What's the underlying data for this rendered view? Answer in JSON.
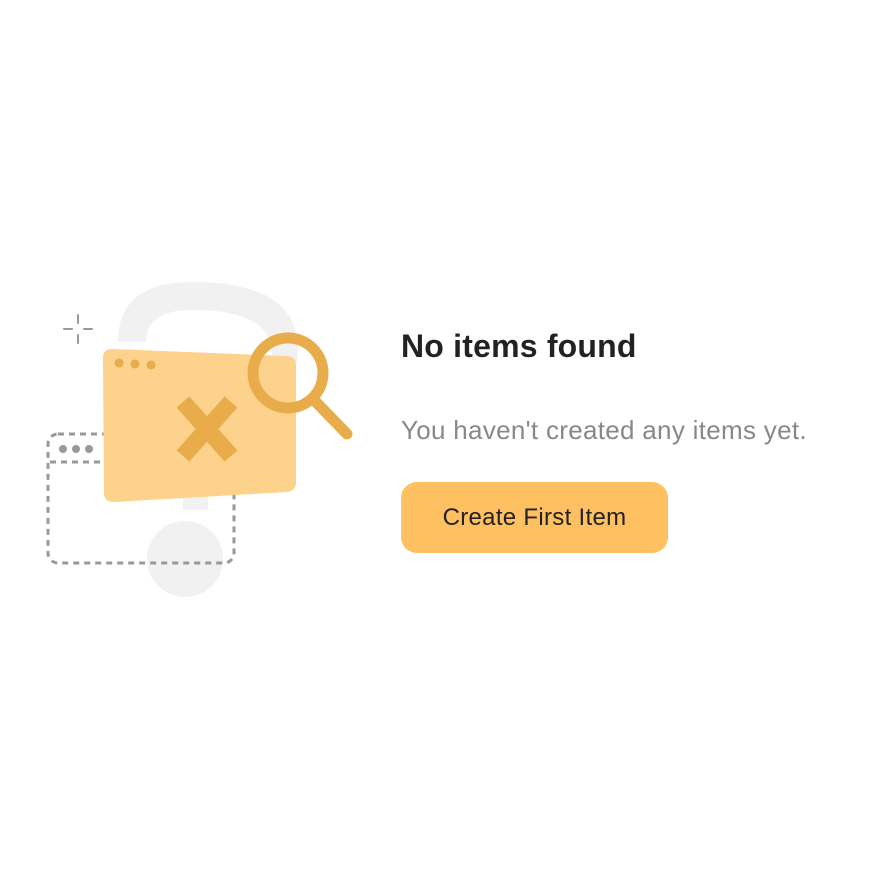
{
  "empty_state": {
    "title": "No items found",
    "message": "You haven't created any items yet.",
    "cta_label": "Create First Item"
  },
  "illustration": {
    "icons": [
      "question-mark-icon",
      "sparkle-icon",
      "dashed-window-icon",
      "folder-error-icon",
      "x-mark-icon",
      "magnifier-icon"
    ]
  },
  "colors": {
    "accent": "#ffc062",
    "accent_dark": "#e8ac4a",
    "folder_fill": "#fdd28c",
    "title_text": "#222222",
    "muted_text": "#888888",
    "question_mark": "#f1f1f1",
    "dashed_stroke": "#999999"
  }
}
